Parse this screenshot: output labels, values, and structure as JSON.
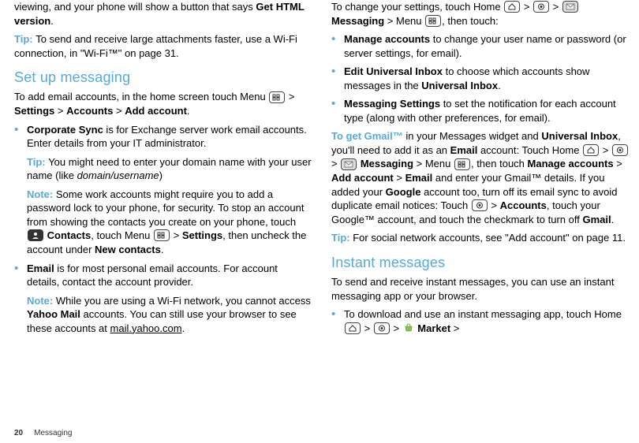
{
  "footer": {
    "page": "20",
    "section": "Messaging"
  },
  "left": {
    "intro1_a": "viewing, and your phone will show a button that says ",
    "intro1_b": "Get HTML version",
    "intro1_c": ".",
    "tip1_lbl": "Tip: ",
    "tip1": "To send and receive large attachments faster, use a Wi-Fi connection, in \"Wi-Fi™\" on page 31.",
    "h1": "Set up messaging",
    "setup1_a": "To add email accounts, in the home screen touch Menu ",
    "setup1_b": " > ",
    "setup1_c": "Settings",
    "setup1_d": " > ",
    "setup1_e": "Accounts",
    "setup1_f": " > ",
    "setup1_g": "Add account",
    "setup1_h": ".",
    "li1_a": "Corporate Sync",
    "li1_b": " is for Exchange server work email accounts. Enter details from your IT administrator.",
    "li1_tip_lbl": "Tip: ",
    "li1_tip_a": "You might need to enter your domain name with your user name (like ",
    "li1_tip_b": "domain/username",
    "li1_tip_c": ")",
    "li1_note_lbl": "Note: ",
    "li1_note_a": "Some work accounts might require you to add a password lock to your phone, for security. To stop an account from showing the contacts you create on your phone, touch ",
    "li1_note_b": " Contacts",
    "li1_note_c": ", touch Menu ",
    "li1_note_d": " > ",
    "li1_note_e": "Settings",
    "li1_note_f": ", then uncheck the account under ",
    "li1_note_g": "New contacts",
    "li1_note_h": ".",
    "li2_a": "Email",
    "li2_b": " is for most personal email accounts. For account details, contact the account provider.",
    "li2_note_lbl": "Note: ",
    "li2_note_a": "While you are using a Wi-Fi network, you cannot access ",
    "li2_note_b": "Yahoo Mail",
    "li2_note_c": " accounts. You can still use your browser to see these accounts at ",
    "li2_note_d": "mail.yahoo.com",
    "li2_note_e": "."
  },
  "right": {
    "r1_a": "To change your settings, touch Home ",
    "r1_b": " > ",
    "r1_c": " > ",
    "r1_d": " Messaging",
    "r1_e": " > Menu ",
    "r1_f": ", then touch:",
    "rb1_a": "Manage accounts",
    "rb1_b": " to change your user name or password (or server settings, for email).",
    "rb2_a": "Edit Universal Inbox",
    "rb2_b": " to choose which accounts show messages in the ",
    "rb2_c": "Universal Inbox",
    "rb2_d": ".",
    "rb3_a": "Messaging Settings",
    "rb3_b": " to set the notification for each account type (along with other preferences, for email).",
    "g_lbl": "To get Gmail™",
    "g_a": " in your Messages widget and ",
    "g_b": "Universal Inbox",
    "g_c": ", you'll need to add it as an ",
    "g_d": "Email",
    "g_e": " account: Touch Home ",
    "g_f": " > ",
    "g_g": " > ",
    "g_h": " Messaging",
    "g_i": " > Menu ",
    "g_j": ", then touch ",
    "g_k": "Manage accounts",
    "g_l": " > ",
    "g_m": "Add account",
    "g_n": " > ",
    "g_o": "Email",
    "g_p": " and enter your Gmail™ details. If you added your ",
    "g_q": "Google",
    "g_r": " account too, turn off its email sync to avoid duplicate email notices: Touch ",
    "g_s": " > ",
    "g_t": "Accounts",
    "g_u": ", touch your Google™ account, and touch the checkmark to turn off ",
    "g_v": "Gmail",
    "g_w": ".",
    "tip2_lbl": "Tip: ",
    "tip2": "For social network accounts, see \"Add account\" on page 11.",
    "h2": "Instant messages",
    "im1": "To send and receive instant messages, you can use an instant messaging app or your browser.",
    "imb1_a": "To download and use an instant messaging app, touch Home ",
    "imb1_b": " > ",
    "imb1_c": " > ",
    "imb1_d": "  Market",
    "imb1_e": " > "
  }
}
